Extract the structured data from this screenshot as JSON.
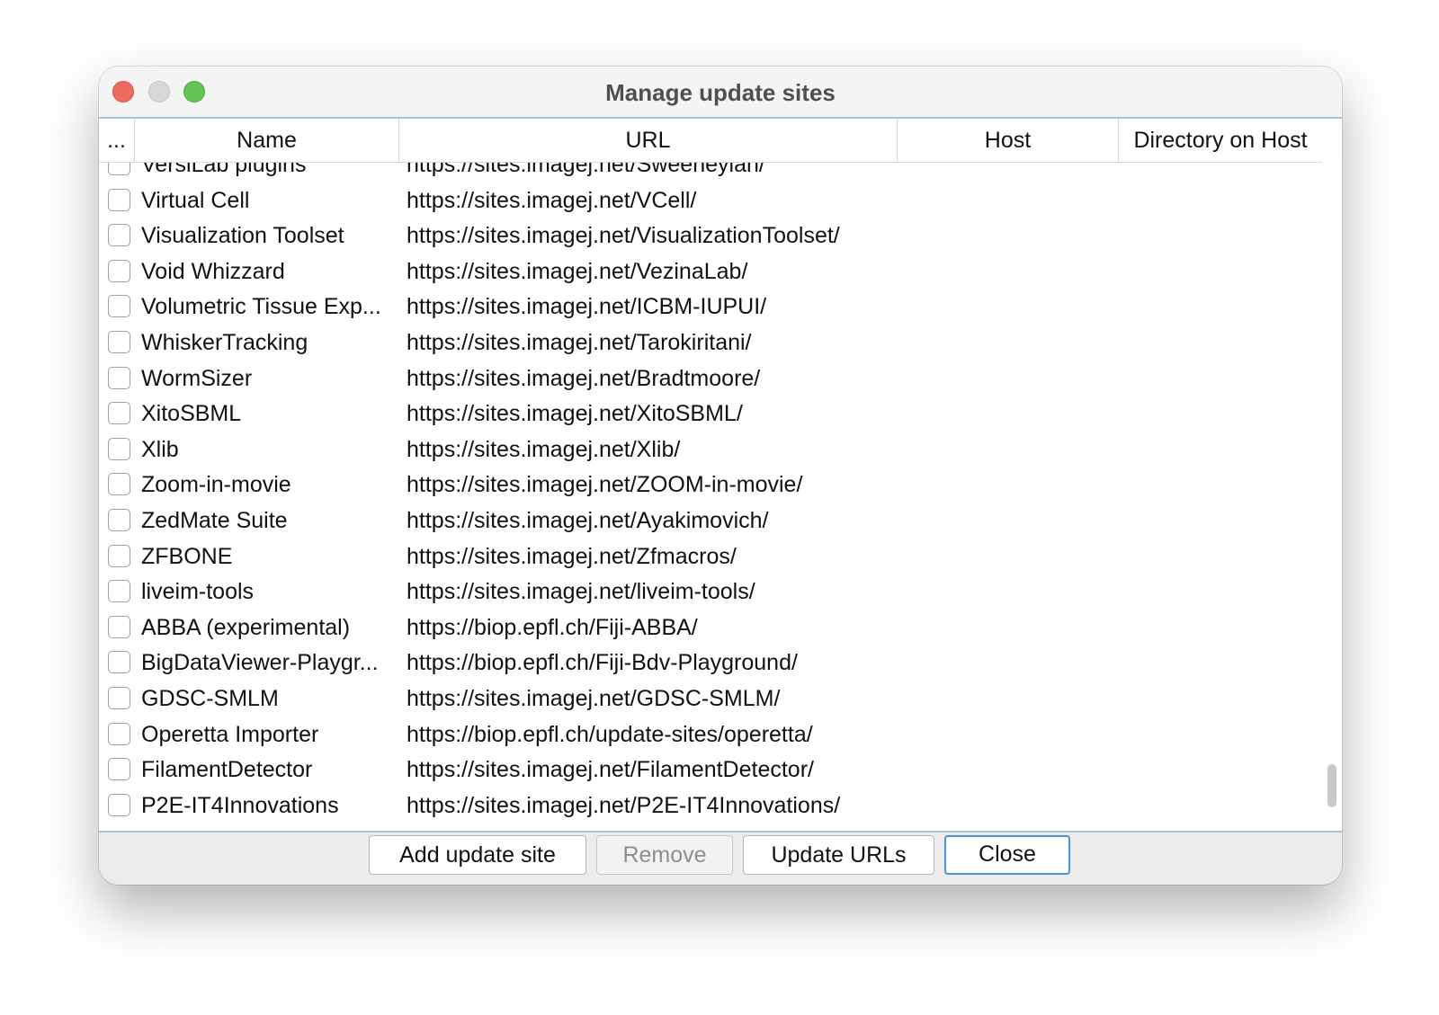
{
  "window": {
    "title": "Manage update sites"
  },
  "table": {
    "columns": [
      "...",
      "Name",
      "URL",
      "Host",
      "Directory on Host"
    ],
    "rows": [
      {
        "checked": false,
        "name": "VersiLab plugins",
        "url": "https://sites.imagej.net/Sweeneyian/",
        "host": "",
        "directory": ""
      },
      {
        "checked": false,
        "name": "Virtual Cell",
        "url": "https://sites.imagej.net/VCell/",
        "host": "",
        "directory": ""
      },
      {
        "checked": false,
        "name": "Visualization Toolset",
        "url": "https://sites.imagej.net/VisualizationToolset/",
        "host": "",
        "directory": ""
      },
      {
        "checked": false,
        "name": "Void Whizzard",
        "url": "https://sites.imagej.net/VezinaLab/",
        "host": "",
        "directory": ""
      },
      {
        "checked": false,
        "name": "Volumetric Tissue Exp...",
        "url": "https://sites.imagej.net/ICBM-IUPUI/",
        "host": "",
        "directory": ""
      },
      {
        "checked": false,
        "name": "WhiskerTracking",
        "url": "https://sites.imagej.net/Tarokiritani/",
        "host": "",
        "directory": ""
      },
      {
        "checked": false,
        "name": "WormSizer",
        "url": "https://sites.imagej.net/Bradtmoore/",
        "host": "",
        "directory": ""
      },
      {
        "checked": false,
        "name": "XitoSBML",
        "url": "https://sites.imagej.net/XitoSBML/",
        "host": "",
        "directory": ""
      },
      {
        "checked": false,
        "name": "Xlib",
        "url": "https://sites.imagej.net/Xlib/",
        "host": "",
        "directory": ""
      },
      {
        "checked": false,
        "name": "Zoom-in-movie",
        "url": "https://sites.imagej.net/ZOOM-in-movie/",
        "host": "",
        "directory": ""
      },
      {
        "checked": false,
        "name": "ZedMate Suite",
        "url": "https://sites.imagej.net/Ayakimovich/",
        "host": "",
        "directory": ""
      },
      {
        "checked": false,
        "name": "ZFBONE",
        "url": "https://sites.imagej.net/Zfmacros/",
        "host": "",
        "directory": ""
      },
      {
        "checked": false,
        "name": "liveim-tools",
        "url": "https://sites.imagej.net/liveim-tools/",
        "host": "",
        "directory": ""
      },
      {
        "checked": false,
        "name": "ABBA (experimental)",
        "url": "https://biop.epfl.ch/Fiji-ABBA/",
        "host": "",
        "directory": ""
      },
      {
        "checked": false,
        "name": "BigDataViewer-Playgr...",
        "url": "https://biop.epfl.ch/Fiji-Bdv-Playground/",
        "host": "",
        "directory": ""
      },
      {
        "checked": false,
        "name": "GDSC-SMLM",
        "url": "https://sites.imagej.net/GDSC-SMLM/",
        "host": "",
        "directory": ""
      },
      {
        "checked": false,
        "name": "Operetta Importer",
        "url": "https://biop.epfl.ch/update-sites/operetta/",
        "host": "",
        "directory": ""
      },
      {
        "checked": false,
        "name": "FilamentDetector",
        "url": "https://sites.imagej.net/FilamentDetector/",
        "host": "",
        "directory": ""
      },
      {
        "checked": false,
        "name": "P2E-IT4Innovations",
        "url": "https://sites.imagej.net/P2E-IT4Innovations/",
        "host": "",
        "directory": ""
      }
    ]
  },
  "buttons": {
    "add": "Add update site",
    "remove": "Remove",
    "update_urls": "Update URLs",
    "close": "Close"
  },
  "colors": {
    "close_light": "#ed6a5e",
    "minimize_light": "#d9d9d9",
    "maximize_light": "#61c554",
    "focus_ring": "#4b92dc"
  }
}
